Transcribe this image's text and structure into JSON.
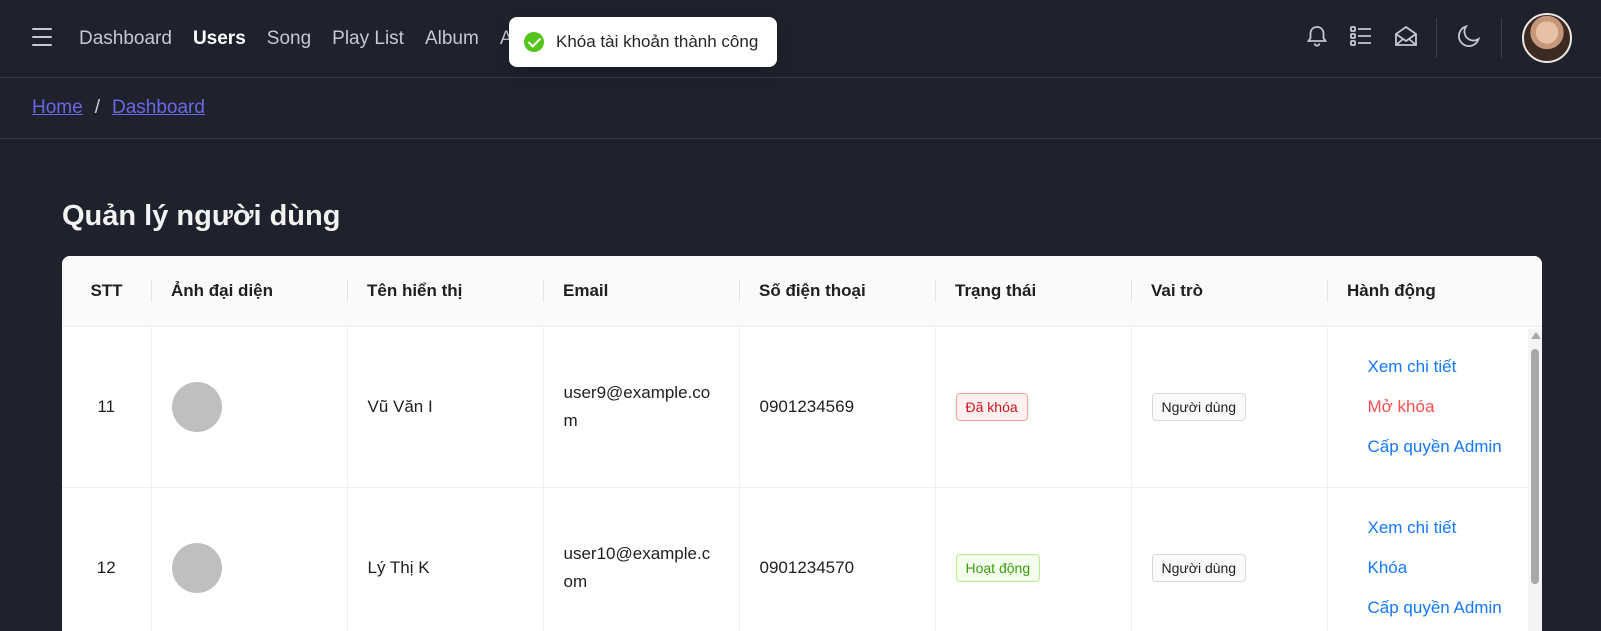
{
  "nav": {
    "items": [
      {
        "label": "Dashboard"
      },
      {
        "label": "Users"
      },
      {
        "label": "Song"
      },
      {
        "label": "Play List"
      },
      {
        "label": "Album"
      },
      {
        "label": "A"
      }
    ],
    "active": "Users"
  },
  "header_icons": [
    "bell-icon",
    "list-icon",
    "mail-icon",
    "moon-icon"
  ],
  "toast": {
    "message": "Khóa tài khoản thành công",
    "icon": "check-circle-icon",
    "color": "#52c41a"
  },
  "breadcrumb": {
    "home": "Home",
    "separator": "/",
    "current": "Dashboard"
  },
  "page": {
    "title": "Quản lý người dùng"
  },
  "table": {
    "columns": [
      "STT",
      "Ảnh đại diện",
      "Tên hiển thị",
      "Email",
      "Số điện thoại",
      "Trạng thái",
      "Vai trò",
      "Hành động"
    ],
    "rows": [
      {
        "stt": "11",
        "name": "Vũ Văn I",
        "email": "user9@example.com",
        "phone": "0901234569",
        "status": "Đã khóa",
        "role": "Người dùng",
        "actions": {
          "view": "Xem chi tiết",
          "toggle": "Mở khóa",
          "admin": "Cấp quyền Admin"
        }
      },
      {
        "stt": "12",
        "name": "Lý Thị K",
        "email": "user10@example.com",
        "phone": "0901234570",
        "status": "Hoạt động",
        "role": "Người dùng",
        "actions": {
          "view": "Xem chi tiết",
          "toggle": "Khóa",
          "admin": "Cấp quyền Admin"
        }
      }
    ]
  },
  "colors": {
    "background": "#1f222c",
    "link": "#6a67e6",
    "action_blue": "#1677ff",
    "action_red": "#ff4d4f"
  }
}
